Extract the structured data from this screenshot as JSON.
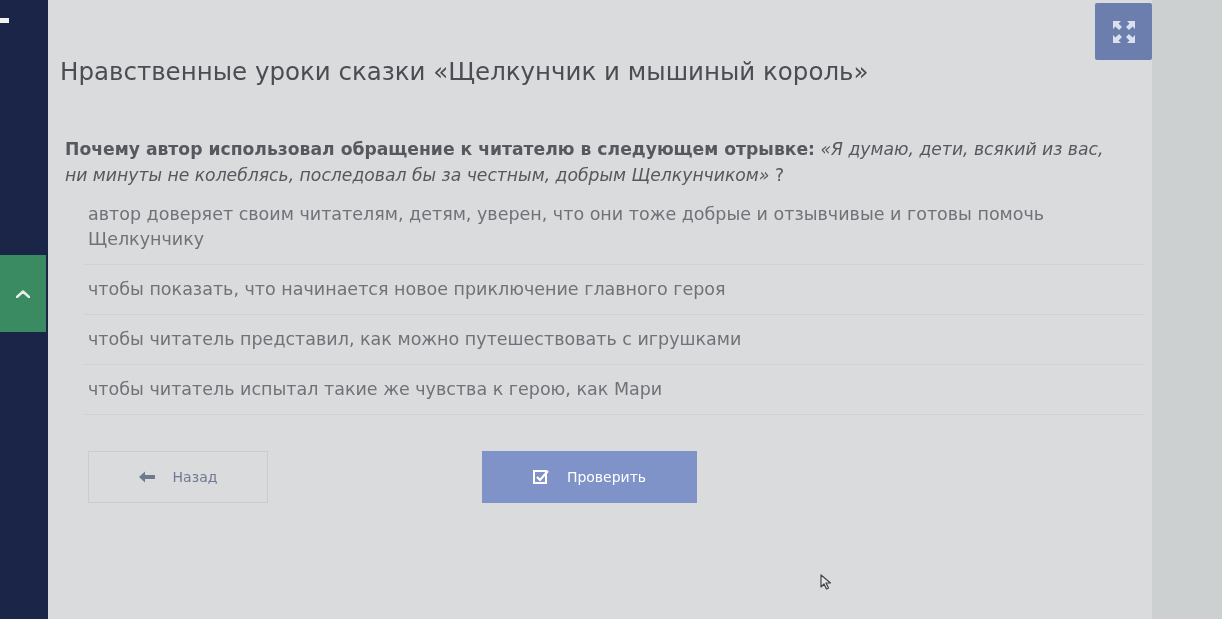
{
  "title": "Нравственные уроки сказки «Щелкунчик и мышиный король»",
  "question": {
    "text": "**Почему автор использовал обращение к читателю в следующем отрывке:** *«Я думаю, дети, всякий из вас, ни минуты не колеблясь, последовал бы за честным, добрым Щелкунчиком»* ?"
  },
  "options": [
    {
      "label": "автор доверяет своим читателям, детям, уверен, что они тоже добрые и отзывчивые и готовы помочь Щелкунчику",
      "selected": false
    },
    {
      "label": "чтобы показать, что начинается новое приключение главного героя",
      "selected": false
    },
    {
      "label": "чтобы читатель представил, как можно путешествовать с игрушками",
      "selected": false
    },
    {
      "label": "чтобы читатель испытал такие же чувства к герою, как Мари",
      "selected": false
    }
  ],
  "buttons": [
    {
      "kind": "back",
      "label": "Назад",
      "disabled": true
    },
    {
      "kind": "check",
      "label": "Проверить",
      "disabled": true
    }
  ]
}
